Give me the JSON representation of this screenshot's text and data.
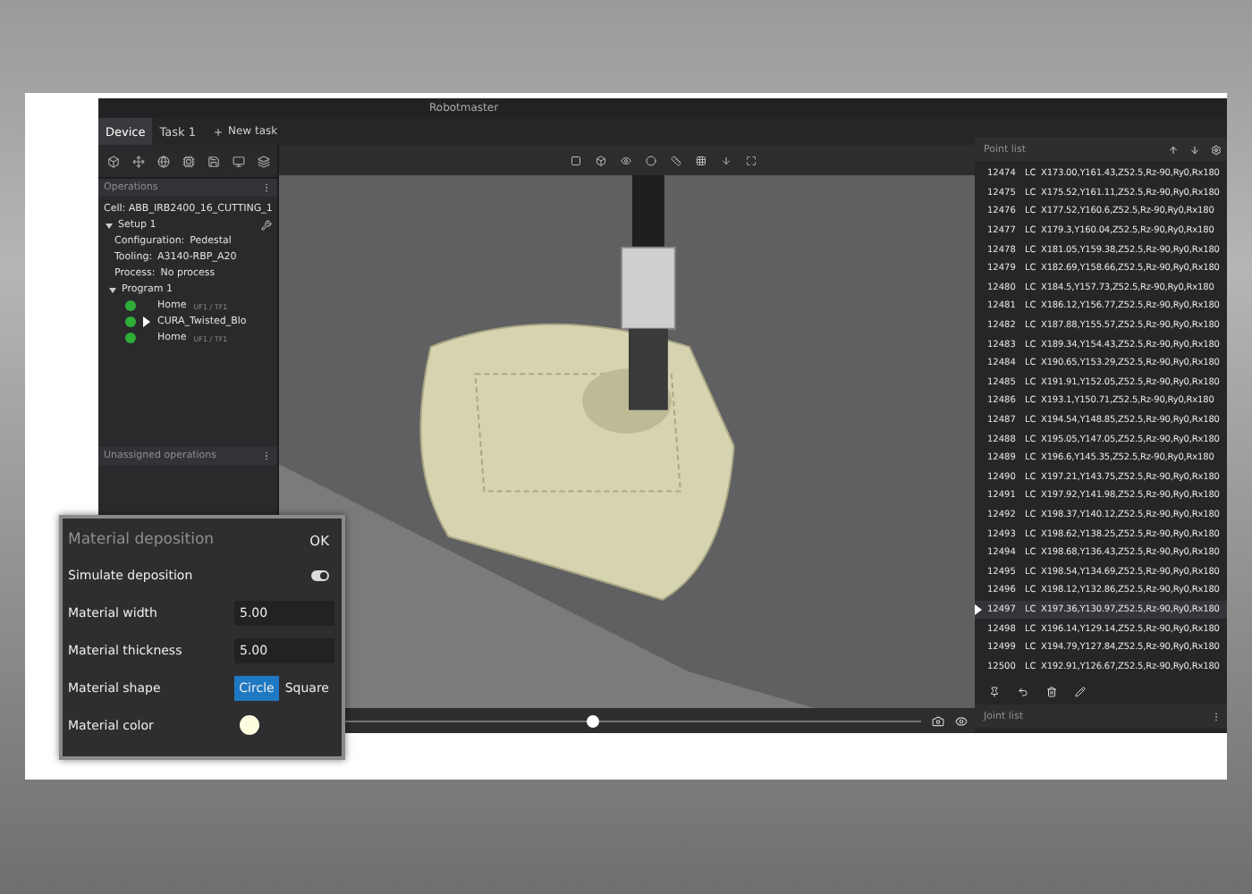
{
  "window": {
    "title": "Robotmaster"
  },
  "tabs": [
    {
      "label": "Device",
      "selected": true
    },
    {
      "label": "Task 1",
      "selected": false
    }
  ],
  "new_task_button": {
    "label": "New task"
  },
  "operations_panel": {
    "title": "Operations",
    "cell": "Cell: ABB_IRB2400_16_CUTTING_1",
    "setup": {
      "label": "Setup 1",
      "expanded": true,
      "properties": [
        {
          "label": "Configuration:",
          "value": "Pedestal"
        },
        {
          "label": "Tooling:",
          "value": "A3140-RBP_A20"
        },
        {
          "label": "Process:",
          "value": "No process"
        }
      ],
      "program": {
        "label": "Program 1",
        "expanded": true,
        "children": [
          {
            "label": "Home",
            "frame": "UF1 / TF1",
            "current": false
          },
          {
            "label": "CURA_Twisted_Blo",
            "current": true
          },
          {
            "label": "Home",
            "frame": "UF1 / TF1",
            "current": false
          }
        ]
      }
    }
  },
  "unassigned_panel": {
    "title": "Unassigned operations"
  },
  "timeline": {
    "level": 0.48
  },
  "point_list": {
    "title": "Point list",
    "rows": [
      {
        "index": "12474",
        "type": "LC",
        "coords": "X173.00,Y161.43,Z52.5,Rz-90,Ry0,Rx180",
        "selected": false
      },
      {
        "index": "12475",
        "type": "LC",
        "coords": "X175.52,Y161.11,Z52.5,Rz-90,Ry0,Rx180",
        "selected": false
      },
      {
        "index": "12476",
        "type": "LC",
        "coords": "X177.52,Y160.6,Z52.5,Rz-90,Ry0,Rx180",
        "selected": false
      },
      {
        "index": "12477",
        "type": "LC",
        "coords": "X179.3,Y160.04,Z52.5,Rz-90,Ry0,Rx180",
        "selected": false
      },
      {
        "index": "12478",
        "type": "LC",
        "coords": "X181.05,Y159.38,Z52.5,Rz-90,Ry0,Rx180",
        "selected": false
      },
      {
        "index": "12479",
        "type": "LC",
        "coords": "X182.69,Y158.66,Z52.5,Rz-90,Ry0,Rx180",
        "selected": false
      },
      {
        "index": "12480",
        "type": "LC",
        "coords": "X184.5,Y157.73,Z52.5,Rz-90,Ry0,Rx180",
        "selected": false
      },
      {
        "index": "12481",
        "type": "LC",
        "coords": "X186.12,Y156.77,Z52.5,Rz-90,Ry0,Rx180",
        "selected": false
      },
      {
        "index": "12482",
        "type": "LC",
        "coords": "X187.88,Y155.57,Z52.5,Rz-90,Ry0,Rx180",
        "selected": false
      },
      {
        "index": "12483",
        "type": "LC",
        "coords": "X189.34,Y154.43,Z52.5,Rz-90,Ry0,Rx180",
        "selected": false
      },
      {
        "index": "12484",
        "type": "LC",
        "coords": "X190.65,Y153.29,Z52.5,Rz-90,Ry0,Rx180",
        "selected": false
      },
      {
        "index": "12485",
        "type": "LC",
        "coords": "X191.91,Y152.05,Z52.5,Rz-90,Ry0,Rx180",
        "selected": false
      },
      {
        "index": "12486",
        "type": "LC",
        "coords": "X193.1,Y150.71,Z52.5,Rz-90,Ry0,Rx180",
        "selected": false
      },
      {
        "index": "12487",
        "type": "LC",
        "coords": "X194.54,Y148.85,Z52.5,Rz-90,Ry0,Rx180",
        "selected": false
      },
      {
        "index": "12488",
        "type": "LC",
        "coords": "X195.05,Y147.05,Z52.5,Rz-90,Ry0,Rx180",
        "selected": false
      },
      {
        "index": "12489",
        "type": "LC",
        "coords": "X196.6,Y145.35,Z52.5,Rz-90,Ry0,Rx180",
        "selected": false
      },
      {
        "index": "12490",
        "type": "LC",
        "coords": "X197.21,Y143.75,Z52.5,Rz-90,Ry0,Rx180",
        "selected": false
      },
      {
        "index": "12491",
        "type": "LC",
        "coords": "X197.92,Y141.98,Z52.5,Rz-90,Ry0,Rx180",
        "selected": false
      },
      {
        "index": "12492",
        "type": "LC",
        "coords": "X198.37,Y140.12,Z52.5,Rz-90,Ry0,Rx180",
        "selected": false
      },
      {
        "index": "12493",
        "type": "LC",
        "coords": "X198.62,Y138.25,Z52.5,Rz-90,Ry0,Rx180",
        "selected": false
      },
      {
        "index": "12494",
        "type": "LC",
        "coords": "X198.68,Y136.43,Z52.5,Rz-90,Ry0,Rx180",
        "selected": false
      },
      {
        "index": "12495",
        "type": "LC",
        "coords": "X198.54,Y134.69,Z52.5,Rz-90,Ry0,Rx180",
        "selected": false
      },
      {
        "index": "12496",
        "type": "LC",
        "coords": "X198.12,Y132.86,Z52.5,Rz-90,Ry0,Rx180",
        "selected": false
      },
      {
        "index": "12497",
        "type": "LC",
        "coords": "X197.36,Y130.97,Z52.5,Rz-90,Ry0,Rx180",
        "selected": true
      },
      {
        "index": "12498",
        "type": "LC",
        "coords": "X196.14,Y129.14,Z52.5,Rz-90,Ry0,Rx180",
        "selected": false
      },
      {
        "index": "12499",
        "type": "LC",
        "coords": "X194.79,Y127.84,Z52.5,Rz-90,Ry0,Rx180",
        "selected": false
      },
      {
        "index": "12500",
        "type": "LC",
        "coords": "X192.91,Y126.67,Z52.5,Rz-90,Ry0,Rx180",
        "selected": false
      }
    ]
  },
  "joint_list": {
    "title": "Joint list"
  },
  "dialog": {
    "title": "Material deposition",
    "ok_button": "OK",
    "simulate": {
      "label": "Simulate deposition",
      "on": true
    },
    "width": {
      "label": "Material width",
      "value": "5.00"
    },
    "thickness": {
      "label": "Material thickness",
      "value": "5.00"
    },
    "shape": {
      "label": "Material shape",
      "options": [
        {
          "label": "Circle",
          "selected": true
        },
        {
          "label": "Square",
          "selected": false
        }
      ]
    },
    "color": {
      "label": "Material color",
      "color": "#fffde0"
    }
  }
}
